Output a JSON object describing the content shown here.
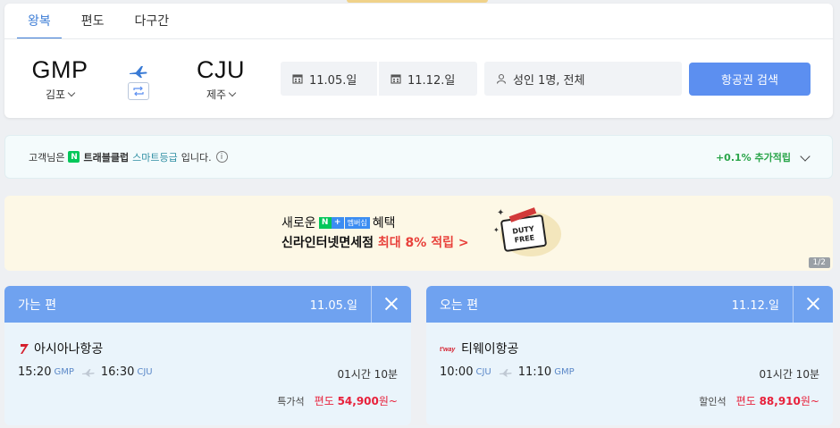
{
  "tabs": [
    {
      "label": "왕복",
      "active": true
    },
    {
      "label": "편도",
      "active": false
    },
    {
      "label": "다구간",
      "active": false
    }
  ],
  "search": {
    "from_code": "GMP",
    "from_city": "김포",
    "to_code": "CJU",
    "to_city": "제주",
    "depart_date": "11.05.일",
    "return_date": "11.12.일",
    "passengers": "성인 1명, 전체",
    "search_label": "항공권 검색"
  },
  "membership": {
    "prefix": "고객님은",
    "n_badge": "N",
    "brand": "트래블클럽",
    "grade": "스마트등급",
    "suffix": "입니다.",
    "info": "i",
    "bonus": "+0.1% 추가적립"
  },
  "banner": {
    "line1_pre": "새로운",
    "badge_n": "N",
    "badge_plus": "+",
    "badge_mem": "멤버십",
    "line1_post": "혜택",
    "line2_main": "신라인터넷면세점",
    "line2_highlight": "최대 8% 적립 >",
    "duty": "DUTY",
    "free": "FREE",
    "pager": "1/2"
  },
  "outbound": {
    "title": "가는 편",
    "date": "11.05.일",
    "airline": "아시아나항공",
    "dep_time": "15:20",
    "dep_ap": "GMP",
    "arr_time": "16:30",
    "arr_ap": "CJU",
    "duration": "01시간 10분",
    "seat_class": "특가석",
    "price_prefix": "편도",
    "price": "54,900",
    "price_suffix": "원~"
  },
  "return": {
    "title": "오는 편",
    "date": "11.12.일",
    "airline": "티웨이항공",
    "dep_time": "10:00",
    "dep_ap": "CJU",
    "arr_time": "11:10",
    "arr_ap": "GMP",
    "duration": "01시간 10분",
    "seat_class": "할인석",
    "price_prefix": "편도",
    "price": "88,910",
    "price_suffix": "원~"
  },
  "colors": {
    "accent": "#3a7bd5",
    "search_button": "#5c8ff0",
    "card_header": "#6fa2f0",
    "price_red": "#e8213b",
    "bonus_green": "#2aa54a"
  },
  "icons": {
    "plane": "plane-icon",
    "swap": "swap-icon",
    "calendar": "calendar-icon",
    "person": "person-icon",
    "close": "close-icon",
    "chevron": "chevron-down-icon"
  }
}
